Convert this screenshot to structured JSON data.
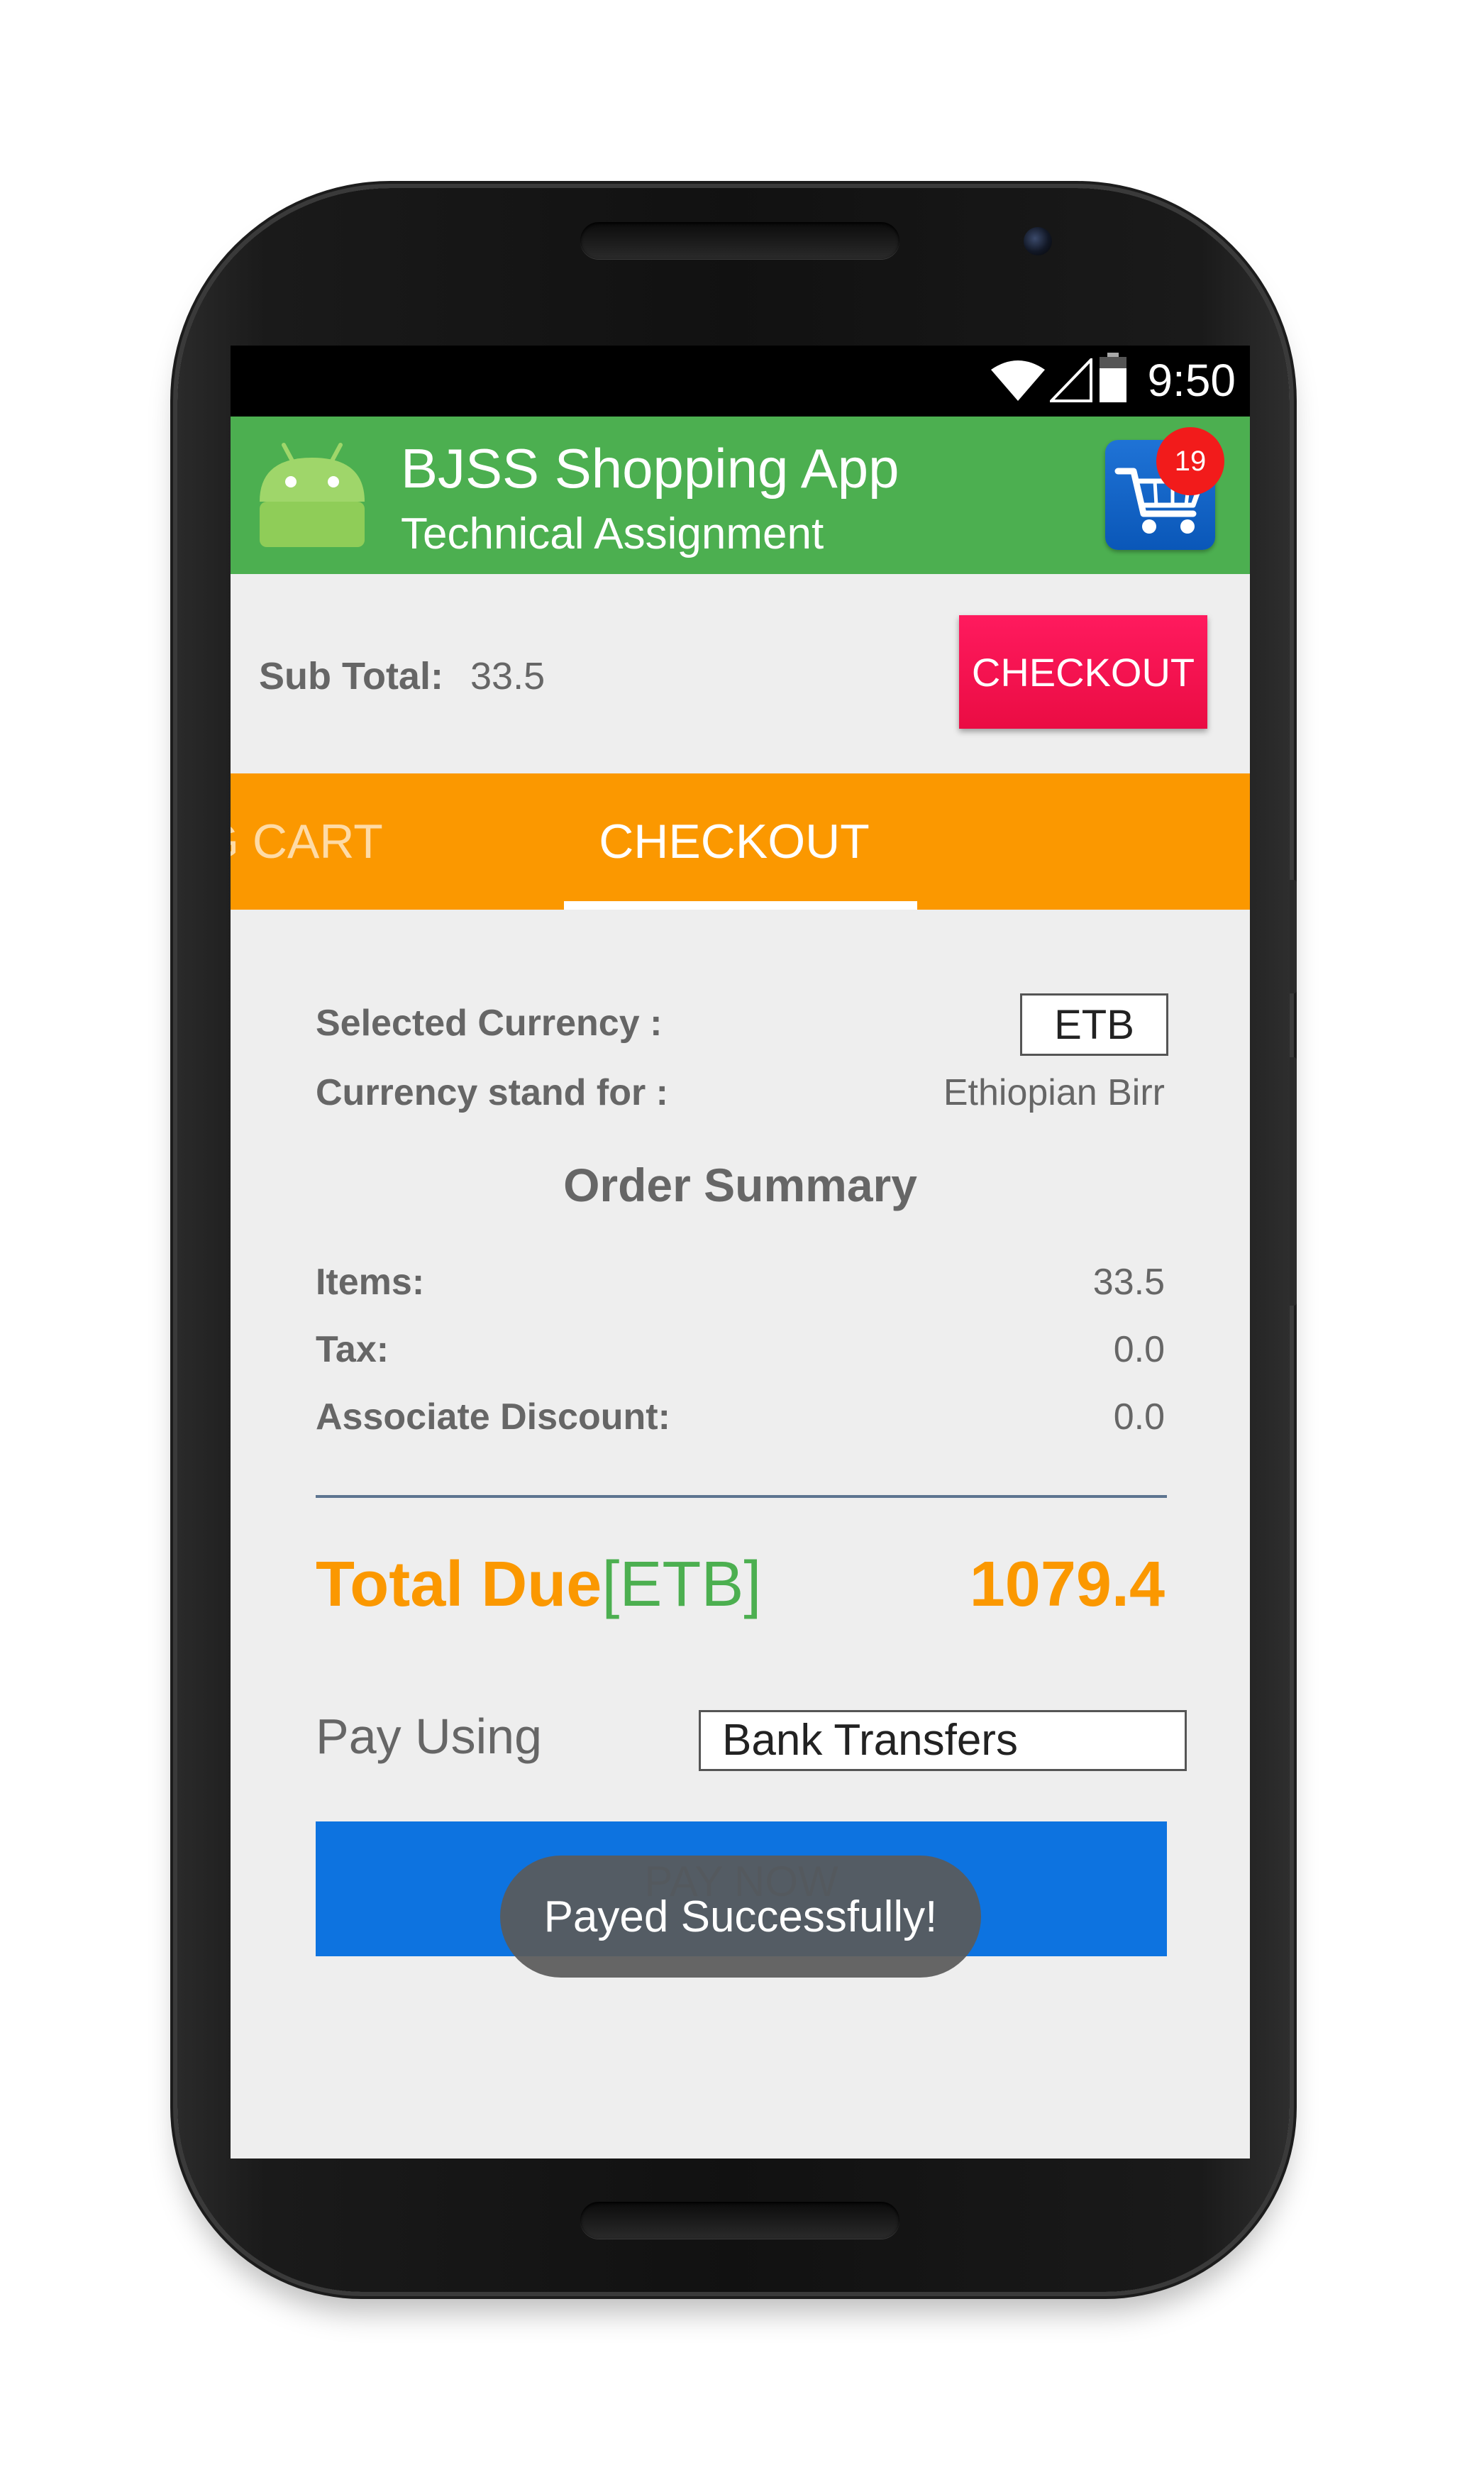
{
  "status_bar": {
    "time": "9:50",
    "icons": [
      "wifi-icon",
      "signal-icon",
      "battery-icon"
    ]
  },
  "app_bar": {
    "title": "BJSS Shopping App",
    "subtitle": "Technical Assignment",
    "logo_icon": "android-icon",
    "cart_icon": "shopping-cart-icon",
    "cart_badge_count": "19"
  },
  "summary_bar": {
    "subtotal_label": "Sub Total:",
    "subtotal_value": "33.5",
    "checkout_button": "CHECKOUT"
  },
  "tabs": [
    {
      "label": "NG CART",
      "selected": false
    },
    {
      "label": "CHECKOUT",
      "selected": true
    }
  ],
  "checkout": {
    "selected_currency_label": "Selected Currency :",
    "selected_currency_value": "ETB",
    "currency_stand_label": "Currency stand for :",
    "currency_stand_value": "Ethiopian Birr",
    "order_summary_title": "Order Summary",
    "items_label": "Items:",
    "items_value": "33.5",
    "tax_label": "Tax:",
    "tax_value": "0.0",
    "discount_label": "Associate Discount:",
    "discount_value": "0.0",
    "total_label": "Total Due",
    "total_currency": "[ETB]",
    "total_value": "1079.4",
    "pay_using_label": "Pay Using",
    "pay_using_value": "Bank Transfers",
    "pay_now_button": "PAY NOW"
  },
  "toast": {
    "message": "Payed Successfully!"
  },
  "colors": {
    "app_bar": "#4caf50",
    "tabs": "#fb9800",
    "checkout_button": "#f0124c",
    "pay_now_button": "#0d73e0",
    "cart_badge": "#f21b1b",
    "total_due": "#fb9800"
  }
}
